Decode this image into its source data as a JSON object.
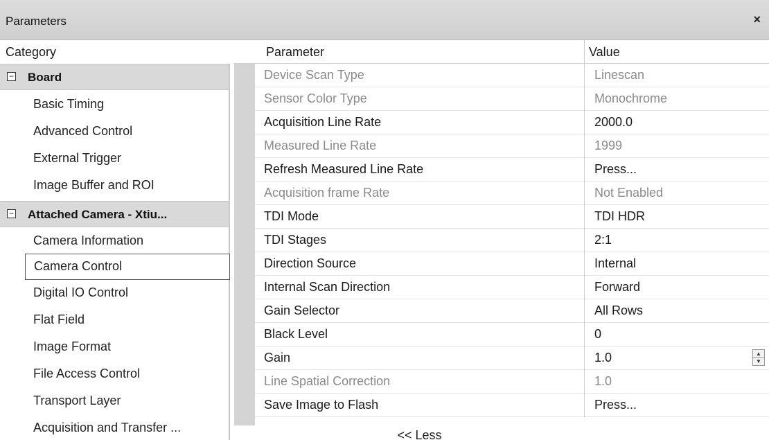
{
  "window": {
    "title": "Parameters",
    "close_glyph": "×"
  },
  "columns": {
    "category": "Category",
    "parameter": "Parameter",
    "value": "Value"
  },
  "categories": {
    "board": {
      "toggle": "⊟",
      "label": "Board",
      "items": [
        "Basic Timing",
        "Advanced Control",
        "External Trigger",
        "Image Buffer and ROI"
      ]
    },
    "camera": {
      "toggle": "⊟",
      "label": "Attached Camera - Xtiu...",
      "items": [
        "Camera Information",
        "Camera Control",
        "Digital IO Control",
        "Flat Field",
        "Image Format",
        "File Access Control",
        "Transport Layer",
        "Acquisition and Transfer ..."
      ],
      "selected": "Camera Control"
    }
  },
  "parameters": [
    {
      "name": "Device Scan Type",
      "value": "Linescan",
      "enabled": false
    },
    {
      "name": "Sensor Color Type",
      "value": "Monochrome",
      "enabled": false
    },
    {
      "name": "Acquisition Line Rate",
      "value": "2000.0",
      "enabled": true
    },
    {
      "name": "Measured Line Rate",
      "value": "1999",
      "enabled": false
    },
    {
      "name": "Refresh Measured Line Rate",
      "value": "Press...",
      "enabled": true
    },
    {
      "name": "Acquisition frame Rate",
      "value": "Not Enabled",
      "enabled": false
    },
    {
      "name": "TDI Mode",
      "value": "TDI HDR",
      "enabled": true
    },
    {
      "name": "TDI Stages",
      "value": "2:1",
      "enabled": true
    },
    {
      "name": "Direction Source",
      "value": "Internal",
      "enabled": true
    },
    {
      "name": "Internal Scan Direction",
      "value": "Forward",
      "enabled": true
    },
    {
      "name": "Gain Selector",
      "value": "All Rows",
      "enabled": true
    },
    {
      "name": "Black Level",
      "value": "0",
      "enabled": true
    },
    {
      "name": "Gain",
      "value": "1.0",
      "enabled": true,
      "spinner": true
    },
    {
      "name": "Line Spatial Correction",
      "value": "1.0",
      "enabled": false
    },
    {
      "name": "Save Image to Flash",
      "value": "Press...",
      "enabled": true
    }
  ],
  "footer": {
    "less_label": "<< Less"
  },
  "icons": {
    "spinner_up": "▲",
    "spinner_down": "▼"
  },
  "colors": {
    "disabled_text": "#8a8a8a",
    "header_gray": "#d9d9d9"
  }
}
